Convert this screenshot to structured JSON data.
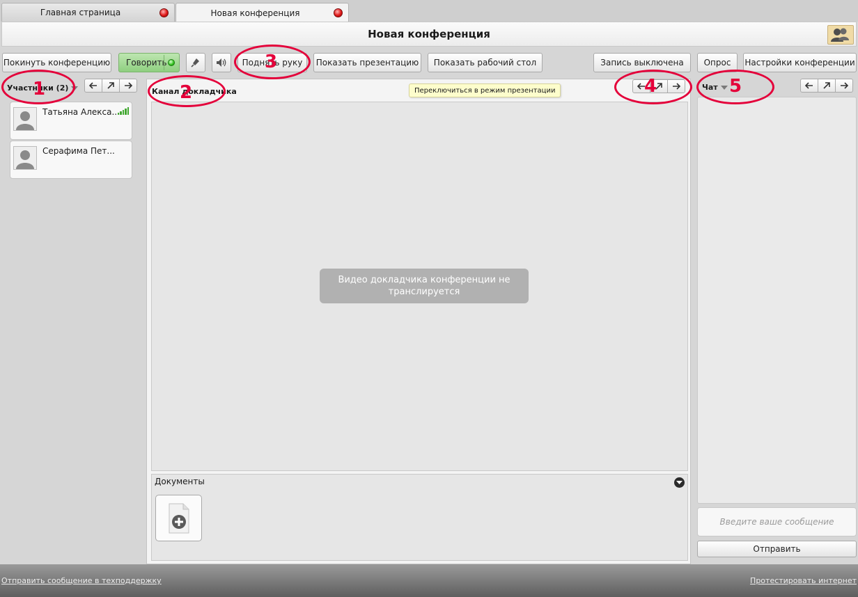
{
  "tabs": [
    {
      "label": "Главная страница"
    },
    {
      "label": "Новая конференция"
    }
  ],
  "header": {
    "title": "Новая конференция"
  },
  "toolbar": {
    "leave": "Покинуть конференцию",
    "speak": "Говорить",
    "raise_hand": "Поднять руку",
    "show_presentation": "Показать презентацию",
    "show_desktop": "Показать рабочий стол",
    "recording": "Запись выключена",
    "poll": "Опрос",
    "settings": "Настройки конференции"
  },
  "participants_panel": {
    "label": "Участники (2)",
    "participants": [
      {
        "name": "Татьяна Алекса..."
      },
      {
        "name": "Серафима Пет..."
      }
    ]
  },
  "speaker_panel": {
    "label": "Канал докладчика",
    "tooltip": "Переключиться в режим презентации",
    "video_message": "Видео докладчика конференции не транслируется",
    "documents_label": "Документы"
  },
  "chat_panel": {
    "label": "Чат",
    "input_placeholder": "Введите ваше сообщение",
    "send_label": "Отправить"
  },
  "annotations": [
    "1",
    "2",
    "3",
    "4",
    "5"
  ],
  "footer": {
    "support_link": "Отправить сообщение в техподдержку",
    "test_link": "Протестировать интернет"
  },
  "colors": {
    "annotation": "#e4003a",
    "speak_active": "#8fcf80",
    "signal": "#43a832"
  }
}
